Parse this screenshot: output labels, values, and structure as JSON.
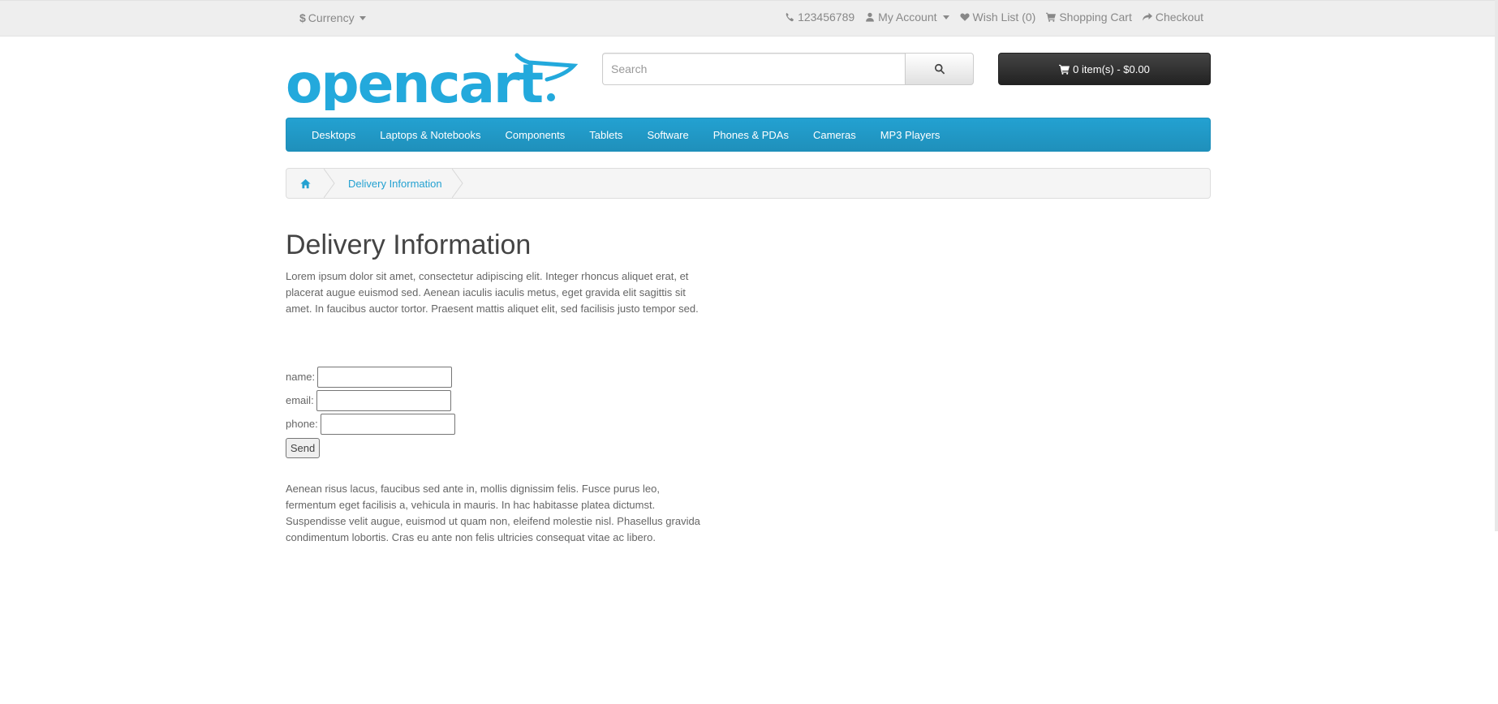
{
  "topbar": {
    "currency_symbol": "$",
    "currency_label": "Currency",
    "phone": "123456789",
    "my_account": "My Account",
    "wish_list": "Wish List (0)",
    "shopping_cart": "Shopping Cart",
    "checkout": "Checkout"
  },
  "header": {
    "logo_text": "opencart",
    "search_placeholder": "Search",
    "cart_label": "0 item(s) - $0.00"
  },
  "menu": {
    "items": [
      "Desktops",
      "Laptops & Notebooks",
      "Components",
      "Tablets",
      "Software",
      "Phones & PDAs",
      "Cameras",
      "MP3 Players"
    ]
  },
  "breadcrumb": {
    "current": "Delivery Information"
  },
  "content": {
    "title": "Delivery Information",
    "para1": "Lorem ipsum dolor sit amet, consectetur adipiscing elit. Integer rhoncus aliquet erat, et placerat augue euismod sed. Aenean iaculis iaculis metus, eget gravida elit sagittis sit amet. In faucibus auctor tortor. Praesent mattis aliquet elit, sed facilisis justo tempor sed.",
    "form": {
      "name_label": "name:",
      "email_label": "email:",
      "phone_label": "phone:",
      "send_label": "Send"
    },
    "para2": "Aenean risus lacus, faucibus sed ante in, mollis dignissim felis. Fusce purus leo, fermentum eget facilisis a, vehicula in mauris. In hac habitasse platea dictumst. Suspendisse velit augue, euismod ut quam non, eleifend molestie nisl. Phasellus gravida condimentum lobortis. Cras eu ante non felis ultricies consequat vitae ac libero."
  },
  "colors": {
    "brand_blue": "#23a1d1",
    "cart_dark": "#2b2b2b",
    "topbar_bg": "#eeeeee"
  },
  "icons": [
    "phone-icon",
    "user-icon",
    "heart-icon",
    "cart-icon",
    "share-icon",
    "search-icon",
    "home-icon"
  ]
}
